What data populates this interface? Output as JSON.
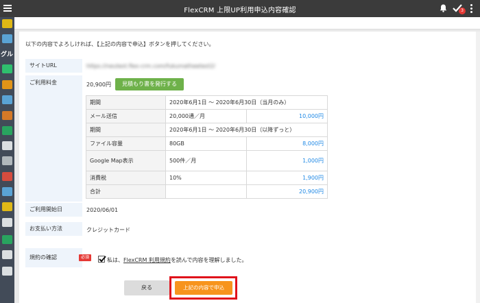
{
  "app": {
    "title": "FlexCRM 上限UP利用申込内容確認",
    "notification_count": "3"
  },
  "sidebar": {
    "items": [
      {
        "icon": "home-icon",
        "color": "#f1c40f"
      },
      {
        "icon": "database-icon",
        "color": "#5dade2"
      },
      {
        "label": "グル"
      },
      {
        "icon": "chevron-right-icon",
        "color": "#2ecc71"
      },
      {
        "icon": "image-icon",
        "color": "#f39c12"
      },
      {
        "icon": "chat-icon",
        "color": "#5dade2"
      },
      {
        "icon": "calendar-icon",
        "color": "#e67e22"
      },
      {
        "icon": "checklist-icon",
        "color": "#27ae60"
      },
      {
        "icon": "document-icon",
        "color": "#ecf0f1"
      },
      {
        "icon": "copy-icon",
        "color": "#bdc3c7"
      },
      {
        "icon": "mail-icon",
        "color": "#e74c3c"
      },
      {
        "icon": "message-icon",
        "color": "#5dade2"
      },
      {
        "icon": "briefcase-icon",
        "color": "#f1c40f"
      },
      {
        "icon": "list-icon",
        "color": "#ecf0f1"
      },
      {
        "icon": "checklist-icon",
        "color": "#27ae60"
      },
      {
        "icon": "card-icon",
        "color": "#ecf0f1"
      },
      {
        "icon": "calculator-icon",
        "color": "#ecf0f1"
      }
    ]
  },
  "form": {
    "intro": "以下の内容でよろしければ、【上記の内容で申込】ボタンを押してください。",
    "site_url_label": "サイトURL",
    "site_url_value": "https://neutest.flex-crm.com/fukumatheetest2/",
    "fee_label": "ご利用料金",
    "fee_total": "20,900円",
    "quote_button": "見積もり書を発行する",
    "start_date_label": "ご利用開始日",
    "start_date_value": "2020/06/01",
    "payment_label": "お支払い方法",
    "payment_value": "クレジットカード",
    "consent_label": "規約の確認",
    "required_badge": "必須",
    "consent_text_prefix": "私は、",
    "consent_link": "FlexCRM 利用規約",
    "consent_text_suffix": "を読んで内容を理解しました。",
    "back_button": "戻る",
    "submit_button": "上記の内容で申込"
  },
  "fees_table": {
    "rows": [
      {
        "label": "期間",
        "detail": "2020年6月1日 ～ 2020年6月30日（当月のみ）",
        "amount": ""
      },
      {
        "label": "メール送信",
        "detail": "20,000通／月",
        "amount": "10,000円"
      },
      {
        "label": "期間",
        "detail": "2020年6月1日 ～ 2020年6月30日（以降ずっと）",
        "amount": ""
      },
      {
        "label": "ファイル容量",
        "detail": "80GB",
        "amount": "8,000円"
      },
      {
        "label": "Google Map表示",
        "detail": "500件／月",
        "amount": "1,000円"
      },
      {
        "label": "消費税",
        "detail": "10%",
        "amount": "1,900円"
      },
      {
        "label": "合計",
        "detail": "",
        "amount": "20,900円"
      }
    ]
  },
  "colors": {
    "topbar": "#3b3b3b",
    "sidebar": "#424b58",
    "quote_button": "#6eb14a",
    "submit_button": "#f7941d",
    "highlight_frame": "#e0111b",
    "amount_text": "#1e88e5"
  }
}
